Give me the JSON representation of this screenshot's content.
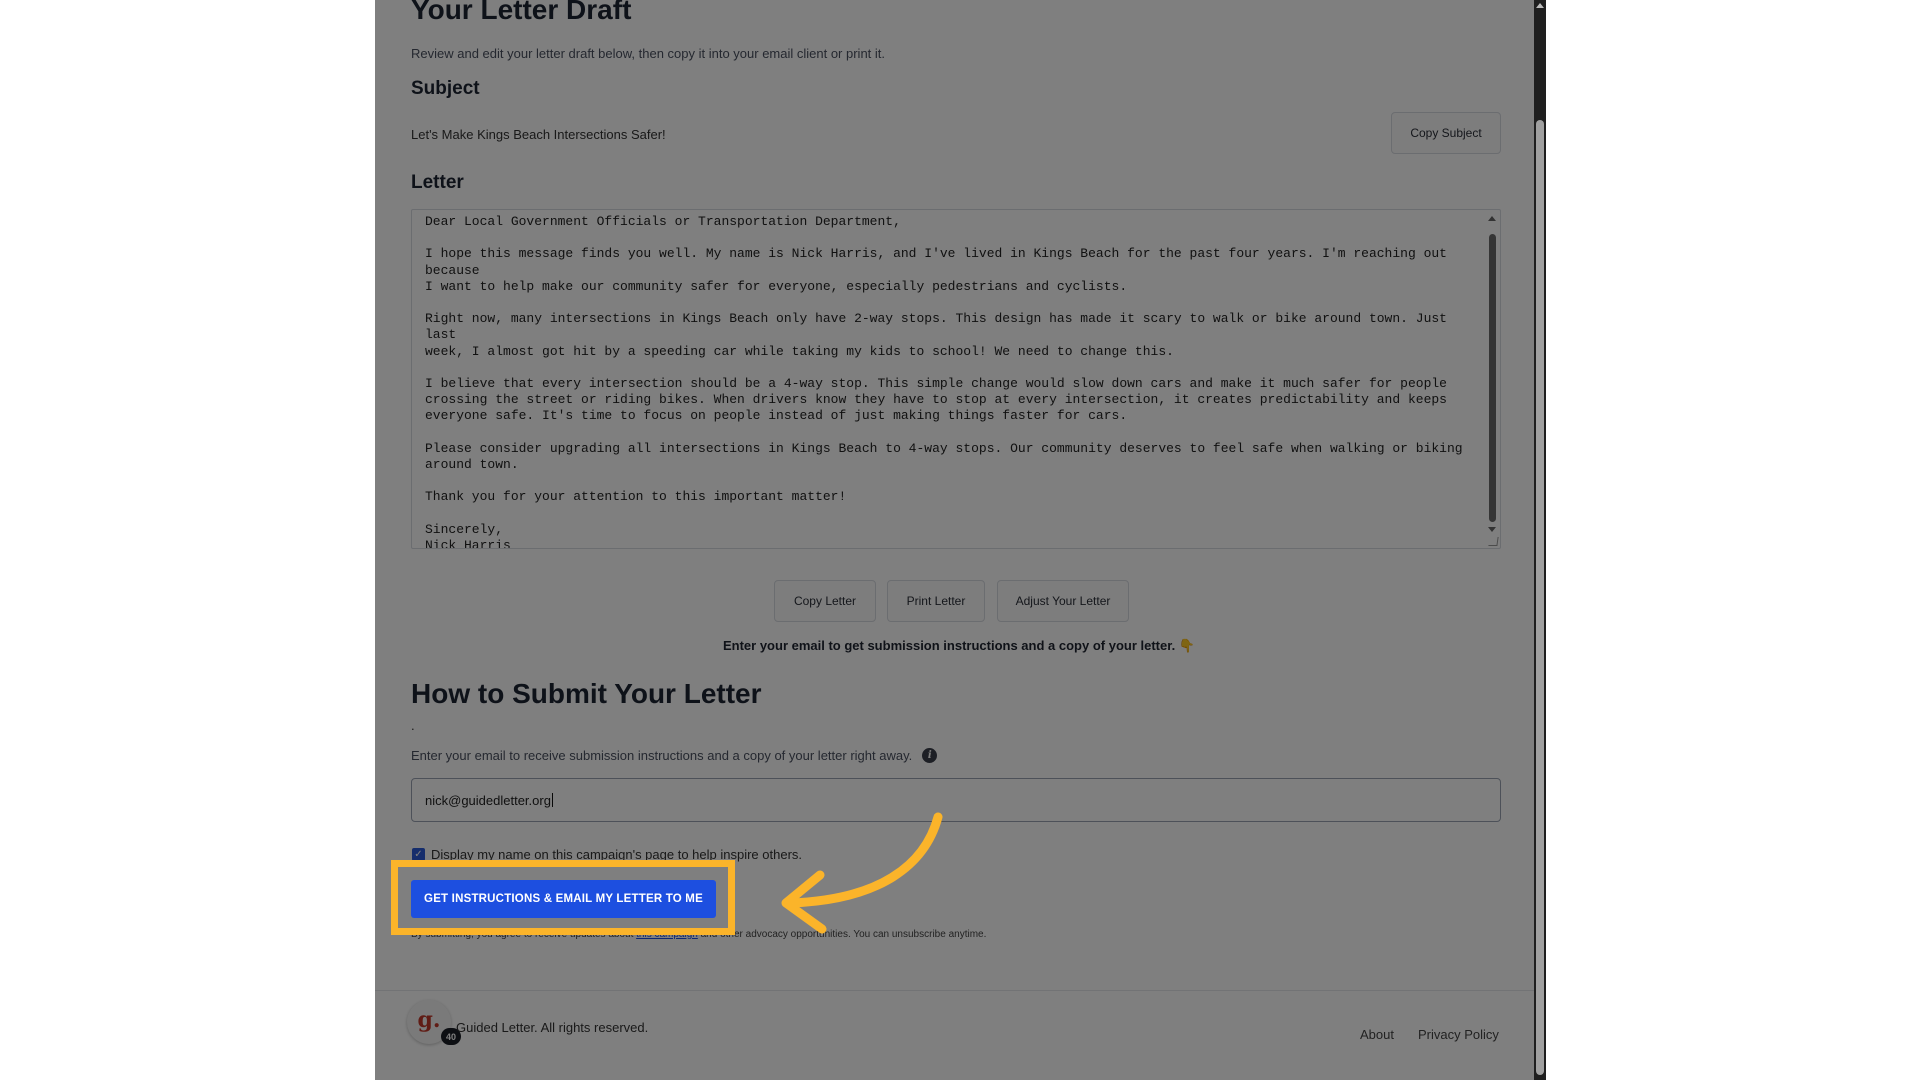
{
  "draft": {
    "title": "Your Letter Draft",
    "intro": "Review and edit your letter draft below, then copy it into your email client or print it."
  },
  "subject": {
    "heading": "Subject",
    "text": "Let's Make Kings Beach Intersections Safer!",
    "copy_button": "Copy Subject"
  },
  "letter": {
    "heading": "Letter",
    "body": "Dear Local Government Officials or Transportation Department,\n\nI hope this message finds you well. My name is Nick Harris, and I've lived in Kings Beach for the past four years. I'm reaching out because\nI want to help make our community safer for everyone, especially pedestrians and cyclists.\n\nRight now, many intersections in Kings Beach only have 2-way stops. This design has made it scary to walk or bike around town. Just last\nweek, I almost got hit by a speeding car while taking my kids to school! We need to change this.\n\nI believe that every intersection should be a 4-way stop. This simple change would slow down cars and make it much safer for people\ncrossing the street or riding bikes. When drivers know they have to stop at every intersection, it creates predictability and keeps\neveryone safe. It's time to focus on people instead of just making things faster for cars.\n\nPlease consider upgrading all intersections in Kings Beach to 4-way stops. Our community deserves to feel safe when walking or biking\naround town.\n\nThank you for your attention to this important matter!\n\nSincerely,\nNick Harris\nKings Beach, CA",
    "buttons": {
      "copy": "Copy Letter",
      "print": "Print Letter",
      "adjust": "Adjust Your Letter"
    }
  },
  "email_hint": "Enter your email to get submission instructions and a copy of your letter.",
  "hand_emoji": "👇",
  "submit": {
    "heading": "How to Submit Your Letter",
    "dot": ".",
    "receive_text": "Enter your email to receive submission instructions and a copy of your letter right away.",
    "email_value": "nick@guidedletter.org",
    "checkbox_label": "Display my name on this campaign's page to help inspire others.",
    "button": "GET INSTRUCTIONS & EMAIL MY LETTER TO ME",
    "legal_before": "By submitting, you agree to receive updates about ",
    "legal_link": "this campaign",
    "legal_after": " and other advocacy opportunities. You can unsubscribe anytime."
  },
  "footer": {
    "logo_letter": "g.",
    "badge": "40",
    "copyright": "Guided Letter. All rights reserved.",
    "about": "About",
    "privacy": "Privacy Policy"
  },
  "colors": {
    "primary": "#1d4fe0",
    "highlight": "#fbb42a",
    "logo": "#c0392b"
  }
}
